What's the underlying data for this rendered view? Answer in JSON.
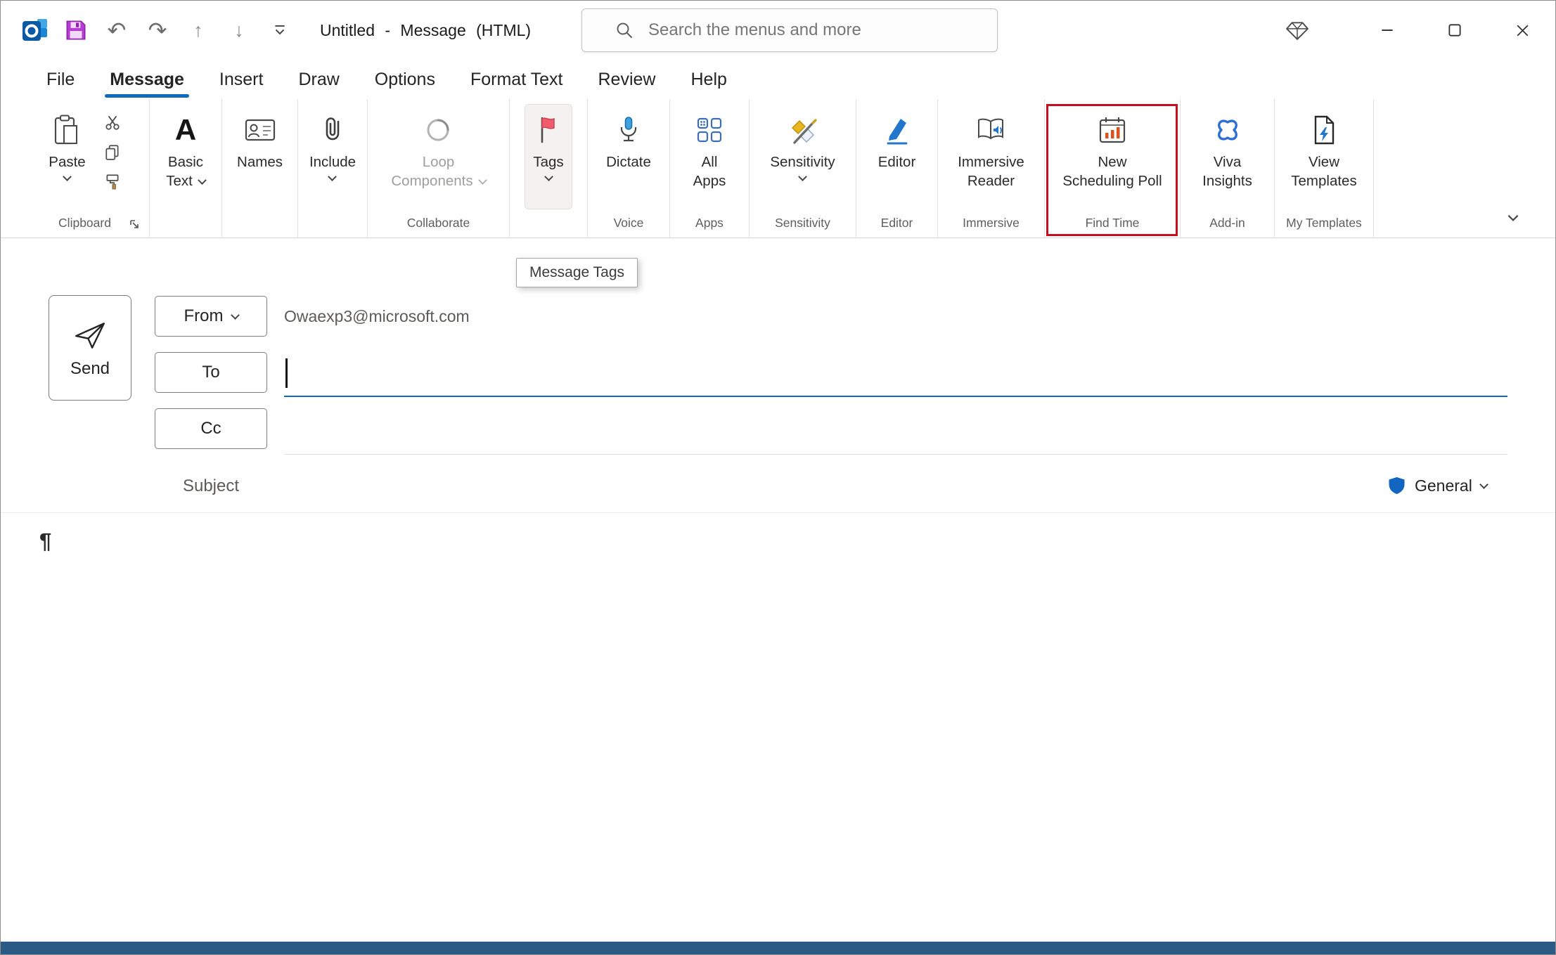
{
  "window": {
    "title": "Untitled - Message (HTML)",
    "search_placeholder": "Search the menus and more"
  },
  "menu": {
    "items": [
      "File",
      "Message",
      "Insert",
      "Draw",
      "Options",
      "Format Text",
      "Review",
      "Help"
    ]
  },
  "ribbon": {
    "clipboard": {
      "paste": "Paste",
      "group_label": "Clipboard"
    },
    "basic_text": {
      "line1": "Basic",
      "line2": "Text"
    },
    "names": {
      "label": "Names"
    },
    "include": {
      "label": "Include"
    },
    "loop": {
      "line1": "Loop",
      "line2": "Components",
      "group_label": "Collaborate"
    },
    "tags": {
      "label": "Tags"
    },
    "dictate": {
      "label": "Dictate",
      "group_label": "Voice"
    },
    "all_apps": {
      "line1": "All",
      "line2": "Apps",
      "group_label": "Apps"
    },
    "sensitivity": {
      "label": "Sensitivity",
      "group_label": "Sensitivity"
    },
    "editor": {
      "label": "Editor",
      "group_label": "Editor"
    },
    "immersive": {
      "line1": "Immersive",
      "line2": "Reader",
      "group_label": "Immersive"
    },
    "scheduling": {
      "line1": "New",
      "line2": "Scheduling Poll",
      "group_label": "Find Time"
    },
    "viva": {
      "line1": "Viva",
      "line2": "Insights",
      "group_label": "Add-in"
    },
    "templates": {
      "line1": "View",
      "line2": "Templates",
      "group_label": "My Templates"
    }
  },
  "tooltip": {
    "text": "Message Tags"
  },
  "compose": {
    "send": "Send",
    "from_label": "From",
    "from_value": "Owaexp3@microsoft.com",
    "to_label": "To",
    "cc_label": "Cc",
    "subject_label": "Subject",
    "sensitivity_label": "General",
    "paragraph_mark": "¶"
  },
  "colors": {
    "accent": "#0f6cbd",
    "highlight_red": "#c50f1f",
    "flag_red": "#f05c6c",
    "status_bar": "#2b5b84"
  }
}
